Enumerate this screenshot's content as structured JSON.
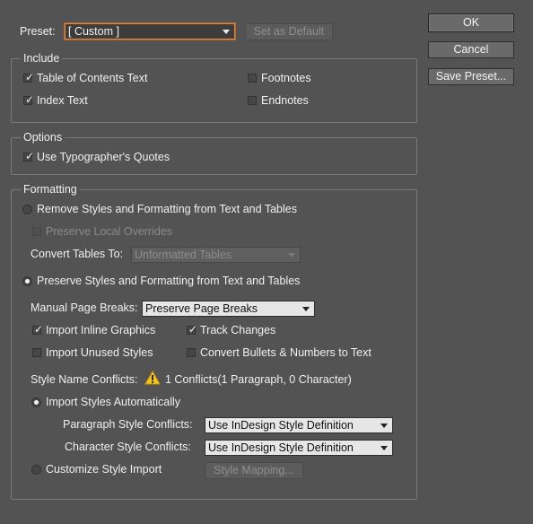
{
  "preset": {
    "label": "Preset:",
    "value": "[ Custom ]",
    "set_default_label": "Set as Default"
  },
  "buttons": {
    "ok": "OK",
    "cancel": "Cancel",
    "save_preset": "Save Preset..."
  },
  "include": {
    "title": "Include",
    "items": [
      {
        "label": "Table of Contents Text",
        "checked": true
      },
      {
        "label": "Footnotes",
        "checked": false
      },
      {
        "label": "Index Text",
        "checked": true
      },
      {
        "label": "Endnotes",
        "checked": false
      }
    ]
  },
  "options": {
    "title": "Options",
    "typographers_quotes": {
      "label": "Use Typographer's Quotes",
      "checked": true
    }
  },
  "formatting": {
    "title": "Formatting",
    "remove_styles": {
      "label": "Remove Styles and Formatting from Text and Tables",
      "selected": false
    },
    "preserve_local": {
      "label": "Preserve Local Overrides",
      "checked": false
    },
    "convert_tables": {
      "label": "Convert Tables To:",
      "value": "Unformatted Tables"
    },
    "preserve_styles": {
      "label": "Preserve Styles and Formatting from Text and Tables",
      "selected": true
    },
    "manual_breaks": {
      "label": "Manual Page Breaks:",
      "value": "Preserve Page Breaks"
    },
    "import_inline": {
      "label": "Import Inline Graphics",
      "checked": true
    },
    "track_changes": {
      "label": "Track Changes",
      "checked": true
    },
    "import_unused": {
      "label": "Import Unused Styles",
      "checked": false
    },
    "convert_bullets": {
      "label": "Convert Bullets & Numbers to Text",
      "checked": false
    },
    "style_conflicts": {
      "label": "Style Name Conflicts:",
      "value": "1 Conflicts(1 Paragraph, 0 Character)"
    },
    "import_auto": {
      "label": "Import Styles Automatically",
      "selected": true
    },
    "para_conflicts": {
      "label": "Paragraph Style Conflicts:",
      "value": "Use InDesign Style Definition"
    },
    "char_conflicts": {
      "label": "Character Style Conflicts:",
      "value": "Use InDesign Style Definition"
    },
    "customize": {
      "label": "Customize Style Import",
      "selected": false
    },
    "style_mapping": "Style Mapping..."
  },
  "colors": {
    "background": "#535353",
    "text": "#f0f0f0",
    "accent_border": "#e8883a",
    "warning": "#f5c518"
  }
}
